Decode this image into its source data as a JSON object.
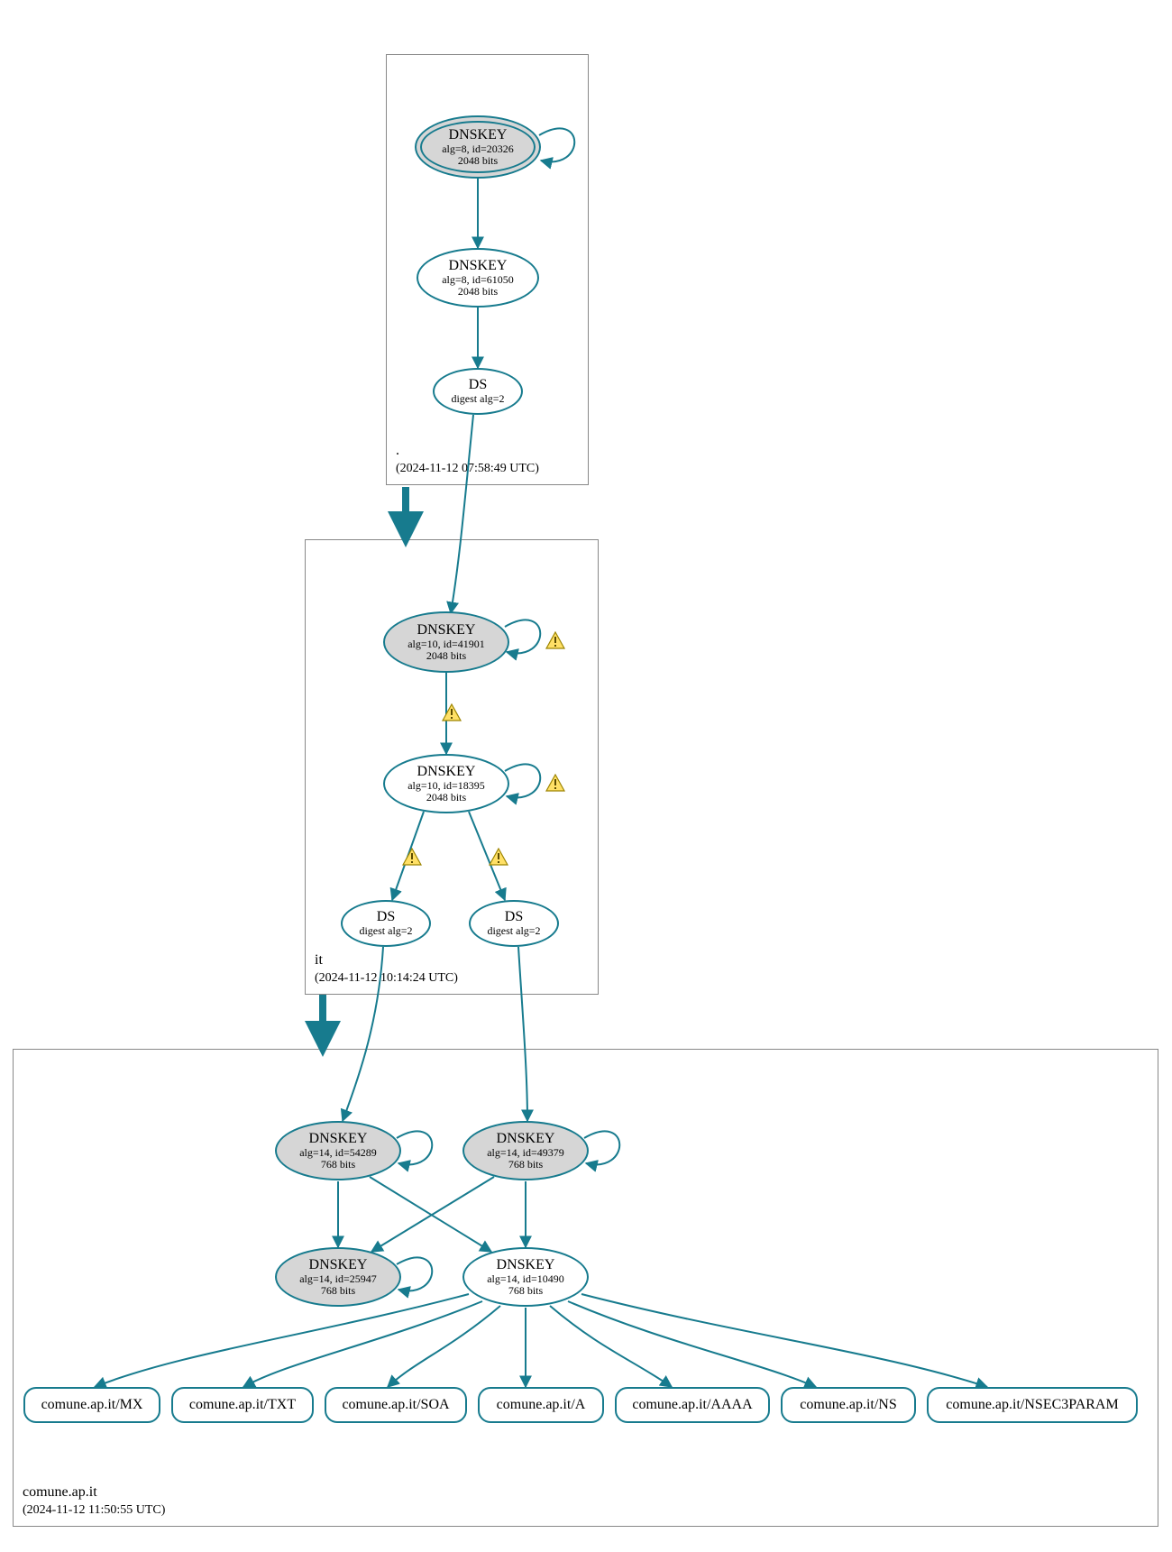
{
  "colors": {
    "stroke": "#177b8e",
    "zone_border": "#888888",
    "ksk_fill": "#d6d6d6",
    "warn_fill": "#ffe066",
    "warn_stroke": "#9c8400"
  },
  "zones": {
    "root": {
      "name": ".",
      "timestamp": "(2024-11-12 07:58:49 UTC)"
    },
    "it": {
      "name": "it",
      "timestamp": "(2024-11-12 10:14:24 UTC)"
    },
    "comune": {
      "name": "comune.ap.it",
      "timestamp": "(2024-11-12 11:50:55 UTC)"
    }
  },
  "nodes": {
    "root_ksk": {
      "title": "DNSKEY",
      "line1": "alg=8, id=20326",
      "line2": "2048 bits"
    },
    "root_zsk": {
      "title": "DNSKEY",
      "line1": "alg=8, id=61050",
      "line2": "2048 bits"
    },
    "root_ds": {
      "title": "DS",
      "line1": "digest alg=2",
      "line2": ""
    },
    "it_ksk": {
      "title": "DNSKEY",
      "line1": "alg=10, id=41901",
      "line2": "2048 bits"
    },
    "it_zsk": {
      "title": "DNSKEY",
      "line1": "alg=10, id=18395",
      "line2": "2048 bits"
    },
    "it_ds1": {
      "title": "DS",
      "line1": "digest alg=2",
      "line2": ""
    },
    "it_ds2": {
      "title": "DS",
      "line1": "digest alg=2",
      "line2": ""
    },
    "c_ksk1": {
      "title": "DNSKEY",
      "line1": "alg=14, id=54289",
      "line2": "768 bits"
    },
    "c_ksk2": {
      "title": "DNSKEY",
      "line1": "alg=14, id=49379",
      "line2": "768 bits"
    },
    "c_ksk3": {
      "title": "DNSKEY",
      "line1": "alg=14, id=25947",
      "line2": "768 bits"
    },
    "c_zsk": {
      "title": "DNSKEY",
      "line1": "alg=14, id=10490",
      "line2": "768 bits"
    }
  },
  "rrsets": {
    "mx": "comune.ap.it/MX",
    "txt": "comune.ap.it/TXT",
    "soa": "comune.ap.it/SOA",
    "a": "comune.ap.it/A",
    "aaaa": "comune.ap.it/AAAA",
    "ns": "comune.ap.it/NS",
    "nsec3": "comune.ap.it/NSEC3PARAM"
  }
}
